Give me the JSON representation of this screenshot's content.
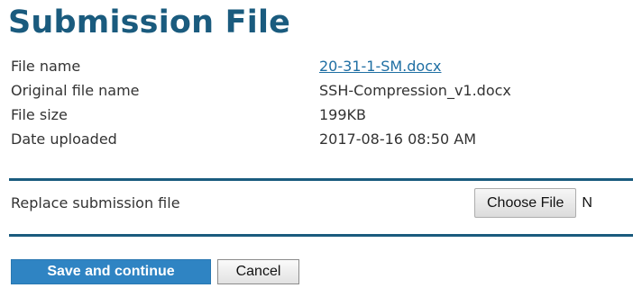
{
  "page_title": "Submission File",
  "file_info": {
    "rows": [
      {
        "label": "File name",
        "value": "20-31-1-SM.docx"
      },
      {
        "label": "Original file name",
        "value": "SSH-Compression_v1.docx"
      },
      {
        "label": "File size",
        "value": "199KB"
      },
      {
        "label": "Date uploaded",
        "value": "2017-08-16 08:50 AM"
      }
    ]
  },
  "replace": {
    "label": "Replace submission file",
    "choose_button": "Choose File",
    "file_status": "N"
  },
  "actions": {
    "save_label": "Save and continue",
    "cancel_label": "Cancel"
  },
  "colors": {
    "title": "#1a5b7e",
    "rule": "#1a5b7e",
    "link": "#1f6fa3",
    "primary_button": "#2f84c3"
  }
}
